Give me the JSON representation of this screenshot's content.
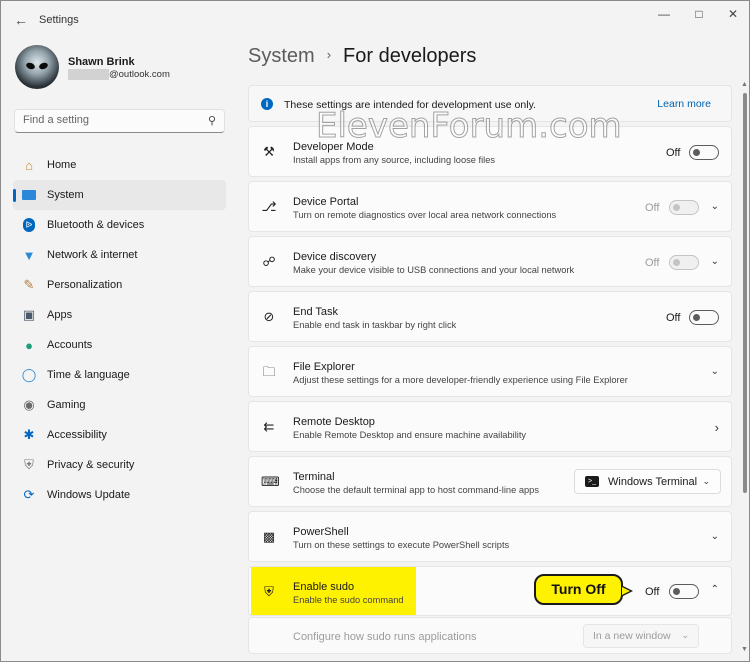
{
  "window": {
    "title": "Settings"
  },
  "user": {
    "name": "Shawn Brink",
    "email_suffix": "@outlook.com"
  },
  "search": {
    "placeholder": "Find a setting"
  },
  "nav": {
    "items": [
      {
        "label": "Home",
        "icon": "home-icon"
      },
      {
        "label": "System",
        "icon": "system-icon",
        "active": true
      },
      {
        "label": "Bluetooth & devices",
        "icon": "bluetooth-icon"
      },
      {
        "label": "Network & internet",
        "icon": "wifi-icon"
      },
      {
        "label": "Personalization",
        "icon": "brush-icon"
      },
      {
        "label": "Apps",
        "icon": "apps-icon"
      },
      {
        "label": "Accounts",
        "icon": "account-icon"
      },
      {
        "label": "Time & language",
        "icon": "globe-icon"
      },
      {
        "label": "Gaming",
        "icon": "gamepad-icon"
      },
      {
        "label": "Accessibility",
        "icon": "accessibility-icon"
      },
      {
        "label": "Privacy & security",
        "icon": "shield-icon"
      },
      {
        "label": "Windows Update",
        "icon": "update-icon"
      }
    ]
  },
  "header": {
    "parent": "System",
    "separator": "›",
    "current": "For developers"
  },
  "info": {
    "text": "These settings are intended for development use only.",
    "link": "Learn more"
  },
  "settings": [
    {
      "title": "Developer Mode",
      "desc": "Install apps from any source, including loose files",
      "state": "Off"
    },
    {
      "title": "Device Portal",
      "desc": "Turn on remote diagnostics over local area network connections",
      "state": "Off"
    },
    {
      "title": "Device discovery",
      "desc": "Make your device visible to USB connections and your local network",
      "state": "Off"
    },
    {
      "title": "End Task",
      "desc": "Enable end task in taskbar by right click",
      "state": "Off"
    },
    {
      "title": "File Explorer",
      "desc": "Adjust these settings for a more developer-friendly experience using File Explorer"
    },
    {
      "title": "Remote Desktop",
      "desc": "Enable Remote Desktop and ensure machine availability"
    },
    {
      "title": "Terminal",
      "desc": "Choose the default terminal app to host command-line apps",
      "dropdown": "Windows Terminal"
    },
    {
      "title": "PowerShell",
      "desc": "Turn on these settings to execute PowerShell scripts"
    },
    {
      "title": "Enable sudo",
      "desc": "Enable the sudo command",
      "state": "Off"
    }
  ],
  "callout": {
    "text": "Turn Off"
  },
  "sudo_sub": {
    "text": "Configure how sudo runs applications",
    "dropdown": "In a new window"
  },
  "watermark": "ElevenForum.com",
  "colors": {
    "accent": "#0067c0",
    "highlight": "#fff200"
  }
}
